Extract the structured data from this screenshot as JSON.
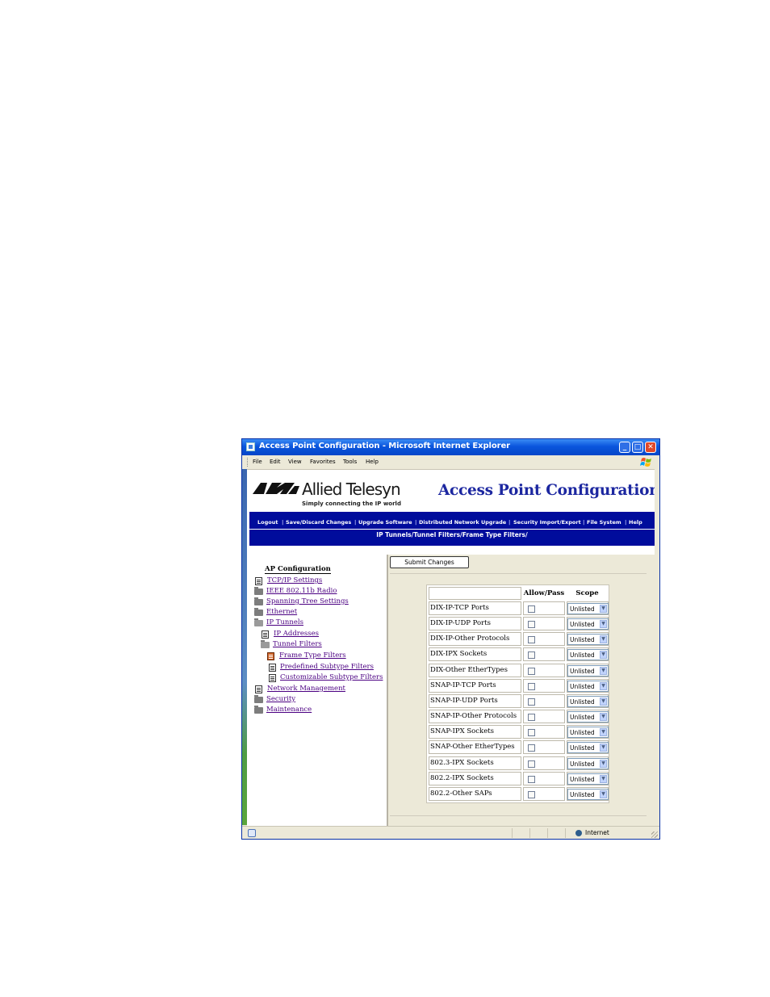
{
  "window": {
    "title": "Access Point Configuration - Microsoft Internet Explorer",
    "controls": {
      "minimize": "_",
      "maximize": "□",
      "close": "✕"
    }
  },
  "menubar": {
    "items": [
      "File",
      "Edit",
      "View",
      "Favorites",
      "Tools",
      "Help"
    ]
  },
  "header": {
    "logo_name": "Allied Telesyn",
    "logo_tagline": "Simply connecting the IP world",
    "title": "Access Point Configuration"
  },
  "navbar": {
    "links": [
      "Logout",
      "Save/Discard Changes",
      "Upgrade Software",
      "Distributed Network Upgrade",
      "Security Import/Export",
      "File System",
      "Help"
    ],
    "separator": "|",
    "breadcrumb": "IP Tunnels/Tunnel Filters/Frame Type Filters/"
  },
  "tree": {
    "root": "AP Configuration",
    "nodes": [
      {
        "label": "TCP/IP Settings",
        "icon": "doc-icon",
        "level": 0
      },
      {
        "label": "IEEE 802.11b Radio",
        "icon": "folder-icon",
        "level": 0
      },
      {
        "label": "Spanning Tree Settings",
        "icon": "folder-icon",
        "level": 0
      },
      {
        "label": "Ethernet",
        "icon": "folder-icon",
        "level": 0
      },
      {
        "label": "IP Tunnels",
        "icon": "open-folder-icon",
        "level": 0
      },
      {
        "label": "IP Addresses",
        "icon": "doc-icon",
        "level": 1
      },
      {
        "label": "Tunnel Filters",
        "icon": "open-folder-icon",
        "level": 1
      },
      {
        "label": "Frame Type Filters",
        "icon": "selected-doc-icon",
        "level": 2
      },
      {
        "label": "Predefined Subtype Filters",
        "icon": "doc-icon",
        "level": 2
      },
      {
        "label": "Customizable Subtype Filters",
        "icon": "doc-icon",
        "level": 2
      },
      {
        "label": "Network Management",
        "icon": "doc-icon",
        "level": 0
      },
      {
        "label": "Security",
        "icon": "folder-icon",
        "level": 0
      },
      {
        "label": "Maintenance",
        "icon": "folder-icon",
        "level": 0
      }
    ]
  },
  "form": {
    "submit_label": "Submit Changes",
    "columns": {
      "name": "",
      "allow": "Allow/Pass",
      "scope": "Scope"
    },
    "rows": [
      {
        "name": "DIX-IP-TCP Ports",
        "allow": false,
        "scope": "Unlisted"
      },
      {
        "name": "DIX-IP-UDP Ports",
        "allow": false,
        "scope": "Unlisted"
      },
      {
        "name": "DIX-IP-Other Protocols",
        "allow": false,
        "scope": "Unlisted"
      },
      {
        "name": "DIX-IPX Sockets",
        "allow": false,
        "scope": "Unlisted"
      },
      {
        "name": "DIX-Other EtherTypes",
        "allow": false,
        "scope": "Unlisted"
      },
      {
        "name": "SNAP-IP-TCP Ports",
        "allow": false,
        "scope": "Unlisted"
      },
      {
        "name": "SNAP-IP-UDP Ports",
        "allow": false,
        "scope": "Unlisted"
      },
      {
        "name": "SNAP-IP-Other Protocols",
        "allow": false,
        "scope": "Unlisted"
      },
      {
        "name": "SNAP-IPX Sockets",
        "allow": false,
        "scope": "Unlisted"
      },
      {
        "name": "SNAP-Other EtherTypes",
        "allow": false,
        "scope": "Unlisted"
      },
      {
        "name": "802.3-IPX Sockets",
        "allow": false,
        "scope": "Unlisted"
      },
      {
        "name": "802.2-IPX Sockets",
        "allow": false,
        "scope": "Unlisted"
      },
      {
        "name": "802.2-Other SAPs",
        "allow": false,
        "scope": "Unlisted"
      }
    ]
  },
  "statusbar": {
    "zone": "Internet"
  },
  "colors": {
    "nav_bg": "#000c9c",
    "title_blue": "#1c27a0",
    "link": "#4b0082",
    "selected_icon": "#d0662a"
  }
}
